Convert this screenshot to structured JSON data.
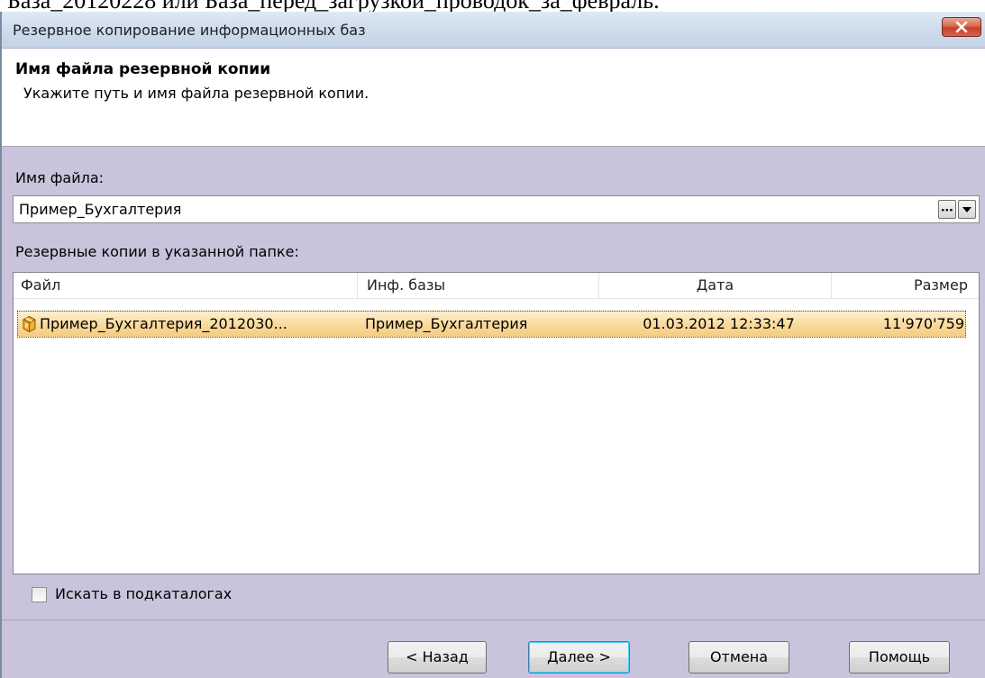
{
  "document": {
    "top_text": "База_20120228 или База_перед_загрузкой_проводок_за_февраль."
  },
  "window": {
    "title": "Резервное копирование информационных баз"
  },
  "header": {
    "title": "Имя файла резервной копии",
    "subtitle": "Укажите путь и имя файла резервной копии."
  },
  "form": {
    "filename_label": "Имя файла:",
    "filename_value": "Пример_Бухгалтерия",
    "browse_label": "...",
    "backups_label": "Резервные копии в указанной папке:"
  },
  "table": {
    "columns": [
      "Файл",
      "Инф. базы",
      "Дата",
      "Размер"
    ],
    "rows": [
      {
        "file": "Пример_Бухгалтерия_2012030...",
        "base": "Пример_Бухгалтерия",
        "date": "01.03.2012 12:33:47",
        "size": "11'970'759",
        "icon": "archive-icon",
        "selected": true
      }
    ]
  },
  "options": {
    "search_subdirs_label": "Искать в подкаталогах",
    "search_subdirs_checked": false
  },
  "buttons": {
    "back": "< Назад",
    "next": "Далее >",
    "cancel": "Отмена",
    "help": "Помощь"
  },
  "colors": {
    "dialog_bg": "#c9c3dc",
    "selection": "#f9d99a",
    "close_button": "#d9694f"
  }
}
